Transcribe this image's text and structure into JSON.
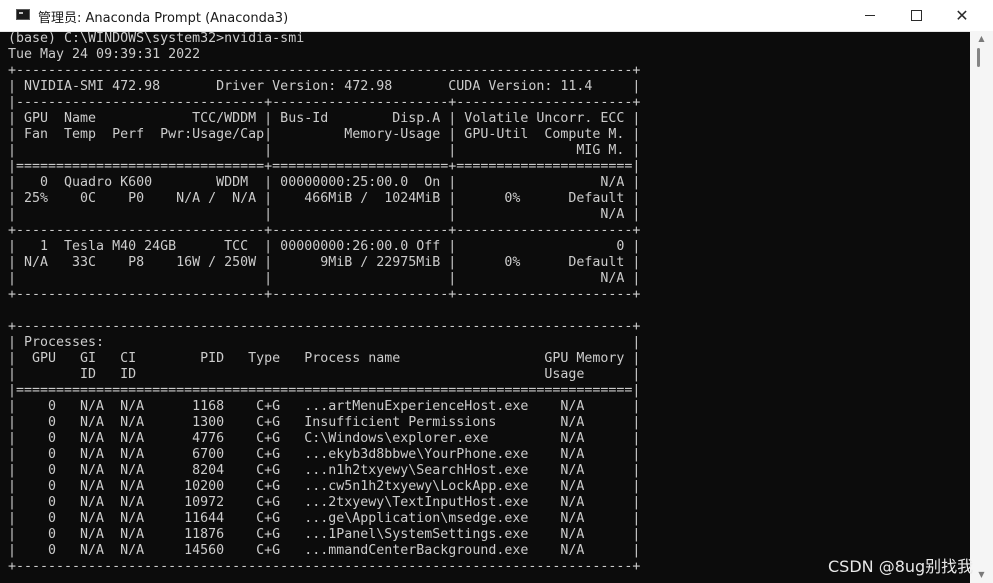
{
  "window": {
    "title": "管理员: Anaconda Prompt (Anaconda3)",
    "icon": "console-icon",
    "controls": {
      "minimize_icon": "minimize-icon",
      "maximize_icon": "maximize-icon",
      "close_label": "✕"
    }
  },
  "terminal": {
    "foreground": "#cccccc",
    "background": "#0c0c0c",
    "lines": [
      "(base) C:\\WINDOWS\\system32>nvidia-smi",
      "Tue May 24 09:39:31 2022",
      "+-----------------------------------------------------------------------------+",
      "| NVIDIA-SMI 472.98       Driver Version: 472.98       CUDA Version: 11.4     |",
      "|-------------------------------+----------------------+----------------------+",
      "| GPU  Name            TCC/WDDM | Bus-Id        Disp.A | Volatile Uncorr. ECC |",
      "| Fan  Temp  Perf  Pwr:Usage/Cap|         Memory-Usage | GPU-Util  Compute M. |",
      "|                               |                      |               MIG M. |",
      "|===============================+======================+======================|",
      "|   0  Quadro K600        WDDM  | 00000000:25:00.0  On |                  N/A |",
      "| 25%    0C    P0    N/A /  N/A |    466MiB /  1024MiB |      0%      Default |",
      "|                               |                      |                  N/A |",
      "+-------------------------------+----------------------+----------------------+",
      "|   1  Tesla M40 24GB      TCC  | 00000000:26:00.0 Off |                    0 |",
      "| N/A   33C    P8    16W / 250W |      9MiB / 22975MiB |      0%      Default |",
      "|                               |                      |                  N/A |",
      "+-------------------------------+----------------------+----------------------+",
      "",
      "+-----------------------------------------------------------------------------+",
      "| Processes:                                                                  |",
      "|  GPU   GI   CI        PID   Type   Process name                  GPU Memory |",
      "|        ID   ID                                                   Usage      |",
      "|=============================================================================|",
      "|    0   N/A  N/A      1168    C+G   ...artMenuExperienceHost.exe    N/A      |",
      "|    0   N/A  N/A      1300    C+G   Insufficient Permissions        N/A      |",
      "|    0   N/A  N/A      4776    C+G   C:\\Windows\\explorer.exe         N/A      |",
      "|    0   N/A  N/A      6700    C+G   ...ekyb3d8bbwe\\YourPhone.exe    N/A      |",
      "|    0   N/A  N/A      8204    C+G   ...n1h2txyewy\\SearchHost.exe    N/A      |",
      "|    0   N/A  N/A     10200    C+G   ...cw5n1h2txyewy\\LockApp.exe    N/A      |",
      "|    0   N/A  N/A     10972    C+G   ...2txyewy\\TextInputHost.exe    N/A      |",
      "|    0   N/A  N/A     11644    C+G   ...ge\\Application\\msedge.exe    N/A      |",
      "|    0   N/A  N/A     11876    C+G   ...1Panel\\SystemSettings.exe    N/A      |",
      "|    0   N/A  N/A     14560    C+G   ...mmandCenterBackground.exe    N/A      |",
      "+-----------------------------------------------------------------------------+"
    ]
  },
  "scrollbar": {
    "up_arrow": "▲",
    "down_arrow": "▼",
    "thumb_position": 0
  },
  "watermark": {
    "text": "CSDN @8ug别找我"
  }
}
